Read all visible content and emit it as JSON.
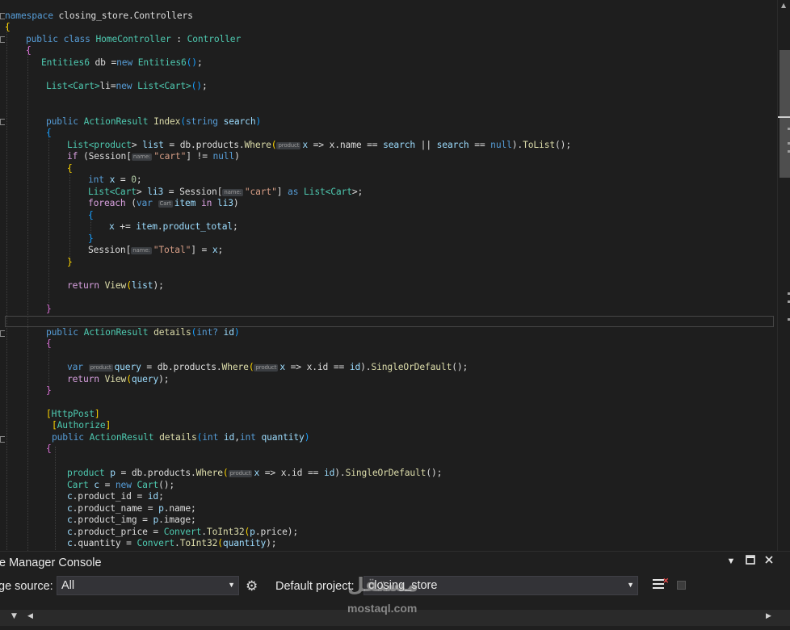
{
  "editor": {
    "lines": {
      "l1": [
        "namespace",
        " closing_store.Controllers"
      ],
      "l2": "{",
      "l3": [
        "public",
        "class",
        "HomeController",
        " : ",
        "Controller"
      ],
      "l4": "{",
      "l5": [
        "Entities6",
        " db ",
        "=",
        "new",
        "Entities6",
        "()",
        ";"
      ],
      "l6": [
        "List<",
        "Cart",
        ">",
        "li",
        "=",
        "new",
        "List<",
        "Cart",
        ">",
        "()",
        ";"
      ],
      "l7": [
        "public",
        "ActionResult",
        "Index",
        "(",
        "string",
        "search",
        ")"
      ],
      "l8": "{",
      "l9": [
        "List<",
        "product",
        "> ",
        "list",
        " = db.products.",
        "Where",
        "(",
        "product",
        "x",
        " => x.name == ",
        "search",
        " || ",
        "search",
        " == ",
        "null",
        ").",
        "ToList",
        "();"
      ],
      "l10": [
        "if",
        " (",
        "Session",
        "[",
        "name:",
        "\"cart\"",
        "] != ",
        "null",
        ")"
      ],
      "l11": "{",
      "l12": [
        "int",
        "x",
        " = ",
        "0",
        ";"
      ],
      "l13": [
        "List<",
        "Cart",
        "> ",
        "li3",
        " = ",
        "Session",
        "[",
        "name:",
        "\"cart\"",
        "] ",
        "as",
        " List<",
        "Cart",
        ">;"
      ],
      "l14": [
        "foreach",
        " (",
        "var",
        "Cart",
        "item",
        " in ",
        "li3",
        ")"
      ],
      "l15": "{",
      "l16": [
        "x",
        " += ",
        "item",
        ".",
        "product_total",
        ";"
      ],
      "l17": "}",
      "l18": [
        "Session",
        "[",
        "name:",
        "\"Total\"",
        "] = ",
        "x",
        ";"
      ],
      "l19": "}",
      "l20": [
        "return",
        "View",
        "(",
        "list",
        ");"
      ],
      "l21": "}",
      "l22": [
        "public",
        "ActionResult",
        "details",
        "(",
        "int?",
        "id",
        ")"
      ],
      "l23": "{",
      "l24": [
        "var",
        "product",
        "query",
        " = db.products.",
        "Where",
        "(",
        "product",
        "x",
        " => x.id == ",
        "id",
        ").",
        "SingleOrDefault",
        "();"
      ],
      "l25": [
        "return",
        "View",
        "(",
        "query",
        ");"
      ],
      "l26": "}",
      "l27": [
        "[",
        "HttpPost",
        "]"
      ],
      "l28": [
        "[",
        "Authorize",
        "]"
      ],
      "l29": [
        "public",
        "ActionResult",
        "details",
        "(",
        "int",
        "id",
        ",",
        "int",
        "quantity",
        ")"
      ],
      "l30": "{",
      "l31": [
        "product",
        "p",
        " = db.products.",
        "Where",
        "(",
        "product",
        "x",
        " => x.id == ",
        "id",
        ").",
        "SingleOrDefault",
        "();"
      ],
      "l32": [
        "Cart",
        "c",
        " = ",
        "new",
        "Cart",
        "();"
      ],
      "l33": [
        "c",
        ".product_id = ",
        "id",
        ";"
      ],
      "l34": [
        "c",
        ".product_name = ",
        "p",
        ".name;"
      ],
      "l35": [
        "c",
        ".product_img = ",
        "p",
        ".image;"
      ],
      "l36": [
        "c",
        ".product_price = ",
        "Convert",
        ".",
        "ToInt32",
        "(",
        "p",
        ".price);"
      ],
      "l37": [
        "c",
        ".quantity = ",
        "Convert",
        ".",
        "ToInt32",
        "(",
        "quantity",
        ");"
      ]
    }
  },
  "console": {
    "title": "e Manager Console",
    "package_source_label": "ge source:",
    "package_source_value": "All",
    "default_project_label": "Default project:",
    "default_project_value": "closing_store"
  },
  "watermark": {
    "logo": "مستقل",
    "text": "mostaql.com"
  },
  "colors": {
    "background": "#1e1e1e",
    "keyword": "#569cd6",
    "type": "#4ec9b0",
    "method": "#dcdcaa",
    "variable": "#9cdcfe",
    "string": "#d69d85"
  },
  "icons": [
    "settings-gear-icon",
    "clear-console-icon",
    "stop-icon",
    "close-icon",
    "maximize-icon",
    "dropdown-arrow-icon"
  ]
}
